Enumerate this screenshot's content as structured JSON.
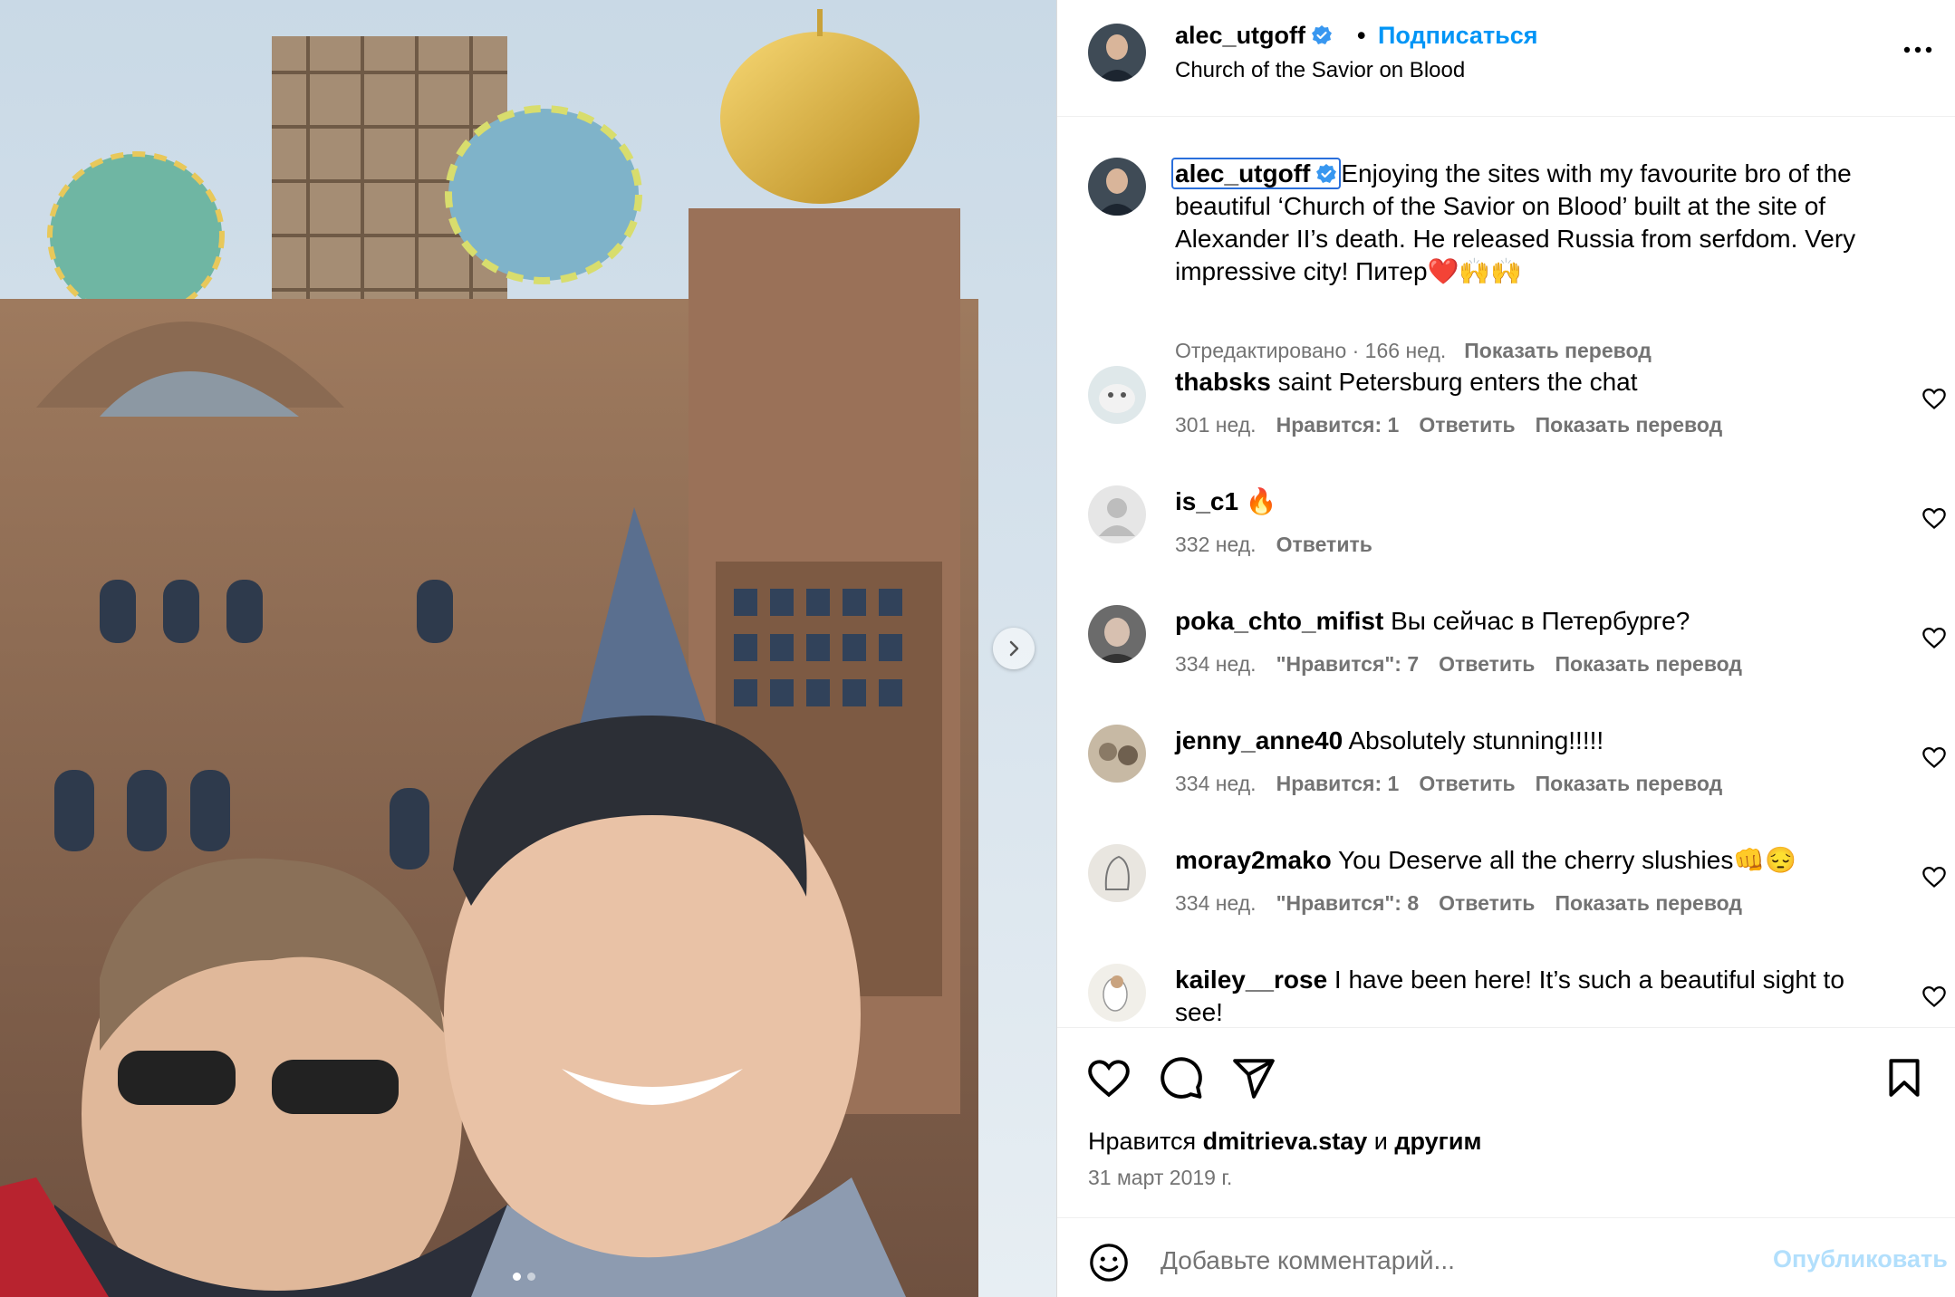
{
  "post": {
    "author": "alec_utgoff",
    "follow_label": "Подписаться",
    "separator": "•",
    "location": "Church of the Savior on Blood",
    "photo_description_icon": "selfie-photo",
    "carousel_dots": 2
  },
  "caption": {
    "user": "alec_utgoff",
    "text": "Enjoying the sites with my favourite bro of the beautiful ‘Church of the Savior on Blood’ built at the site of Alexander II’s death. He released Russia from serfdom. Very impressive city! Питер❤️🙌🙌",
    "meta": "Отредактировано · 166 нед.",
    "translate": "Показать перевод"
  },
  "comments": [
    {
      "user": "thabsks",
      "text": "saint Petersburg enters the chat",
      "time": "301 нед.",
      "likes": "Нравится: 1",
      "reply": "Ответить",
      "translate": "Показать перевод"
    },
    {
      "user": "is_c1",
      "text": "🔥",
      "time": "332 нед.",
      "likes": "",
      "reply": "Ответить",
      "translate": ""
    },
    {
      "user": "poka_chto_mifist",
      "text": "Вы сейчас в Петербурге?",
      "time": "334 нед.",
      "likes": "\"Нравится\": 7",
      "reply": "Ответить",
      "translate": "Показать перевод"
    },
    {
      "user": "jenny_anne40",
      "text": "Absolutely stunning!!!!!",
      "time": "334 нед.",
      "likes": "Нравится: 1",
      "reply": "Ответить",
      "translate": "Показать перевод"
    },
    {
      "user": "moray2mako",
      "text": "You Deserve all the cherry slushies👊😔",
      "time": "334 нед.",
      "likes": "\"Нравится\": 8",
      "reply": "Ответить",
      "translate": "Показать перевод"
    },
    {
      "user": "kailey__rose",
      "text": "I have been here! It’s such a beautiful sight to see!",
      "time": "",
      "likes": "",
      "reply": "",
      "translate": ""
    }
  ],
  "footer": {
    "likes_prefix": "Нравится",
    "likes_user": "dmitrieva.stay",
    "likes_conj": "и",
    "likes_suffix": "другим",
    "date": "31 март 2019 г.",
    "comment_placeholder": "Добавьте комментарий...",
    "publish_label": "Опубликовать"
  },
  "icons": {
    "verified": "verified-badge-icon",
    "more": "more-options-icon",
    "like": "heart-icon",
    "comment": "comment-icon",
    "share": "share-icon",
    "save": "bookmark-icon",
    "emoji": "emoji-icon",
    "next": "chevron-right-icon"
  },
  "colors": {
    "accent": "#0095f6",
    "publish_disabled": "#b2dffc",
    "secondary_text": "#737373",
    "verified": "#3897f0"
  }
}
